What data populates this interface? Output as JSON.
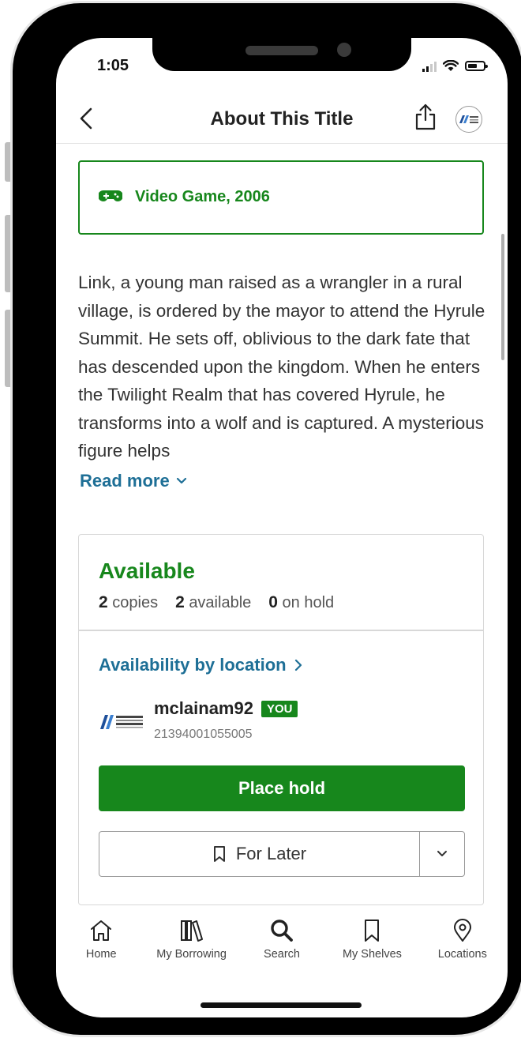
{
  "status_bar": {
    "time": "1:05"
  },
  "header": {
    "title": "About This Title"
  },
  "format": {
    "label": "Video Game, 2006"
  },
  "description": {
    "text": "Link, a young man raised as a wrangler in a rural village, is ordered by the mayor to attend the Hyrule Summit. He sets off, oblivious to the dark fate that has descended upon the kingdom. When he enters the Twilight Realm that has covered Hyrule, he transforms into a wolf and is captured. A mysterious figure helps",
    "read_more": "Read more"
  },
  "availability": {
    "status": "Available",
    "copies_count": "2",
    "copies_label": "copies",
    "available_count": "2",
    "available_label": "available",
    "hold_count": "0",
    "hold_label": "on hold",
    "by_location": "Availability by location"
  },
  "account": {
    "username": "mclainam92",
    "badge": "YOU",
    "card_number": "21394001055005"
  },
  "actions": {
    "place_hold": "Place hold",
    "for_later": "For Later"
  },
  "tabs": [
    {
      "label": "Home",
      "icon": "home-icon"
    },
    {
      "label": "My Borrowing",
      "icon": "books-icon"
    },
    {
      "label": "Search",
      "icon": "search-icon"
    },
    {
      "label": "My Shelves",
      "icon": "bookmark-icon"
    },
    {
      "label": "Locations",
      "icon": "location-pin-icon"
    }
  ],
  "colors": {
    "accent_green": "#17871c",
    "link_blue": "#1e6f96"
  }
}
